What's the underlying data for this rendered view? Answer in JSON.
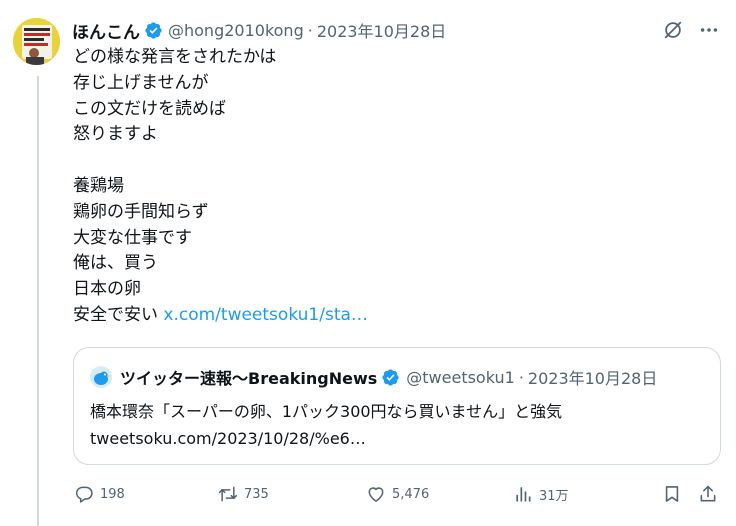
{
  "tweet": {
    "display_name": "ほんこん",
    "handle": "@hong2010kong",
    "separator": "·",
    "date": "2023年10月28日",
    "lines": [
      "どの様な発言をされたかは",
      "存じ上げませんが",
      "この文だけを読めば",
      "怒りますよ",
      "",
      "養鶏場",
      "鶏卵の手間知らず",
      "大変な仕事です",
      "俺は、買う",
      "日本の卵"
    ],
    "last_line_prefix": "安全で安い ",
    "last_line_link": "x.com/tweetsoku1/sta…"
  },
  "quote": {
    "display_name": "ツイッター速報〜BreakingNews",
    "handle": "@tweetsoku1",
    "separator": "·",
    "date": "2023年10月28日",
    "lines": [
      "橋本環奈「スーパーの卵、1パック300円なら買いません」と強気",
      "tweetsoku.com/2023/10/28/%e6…"
    ]
  },
  "actions": {
    "replies": "198",
    "retweets": "735",
    "likes": "5,476",
    "views": "31万"
  },
  "icons": {
    "verified": "verified-badge-icon",
    "grok": "grok-icon",
    "more": "more-icon",
    "reply": "reply-icon",
    "retweet": "retweet-icon",
    "like": "heart-icon",
    "views": "views-icon",
    "bookmark": "bookmark-icon",
    "share": "share-icon"
  },
  "colors": {
    "text": "#0f1419",
    "muted": "#536471",
    "link": "#1d9bf0",
    "border": "#cfd9de",
    "verified": "#1d9bf0"
  }
}
